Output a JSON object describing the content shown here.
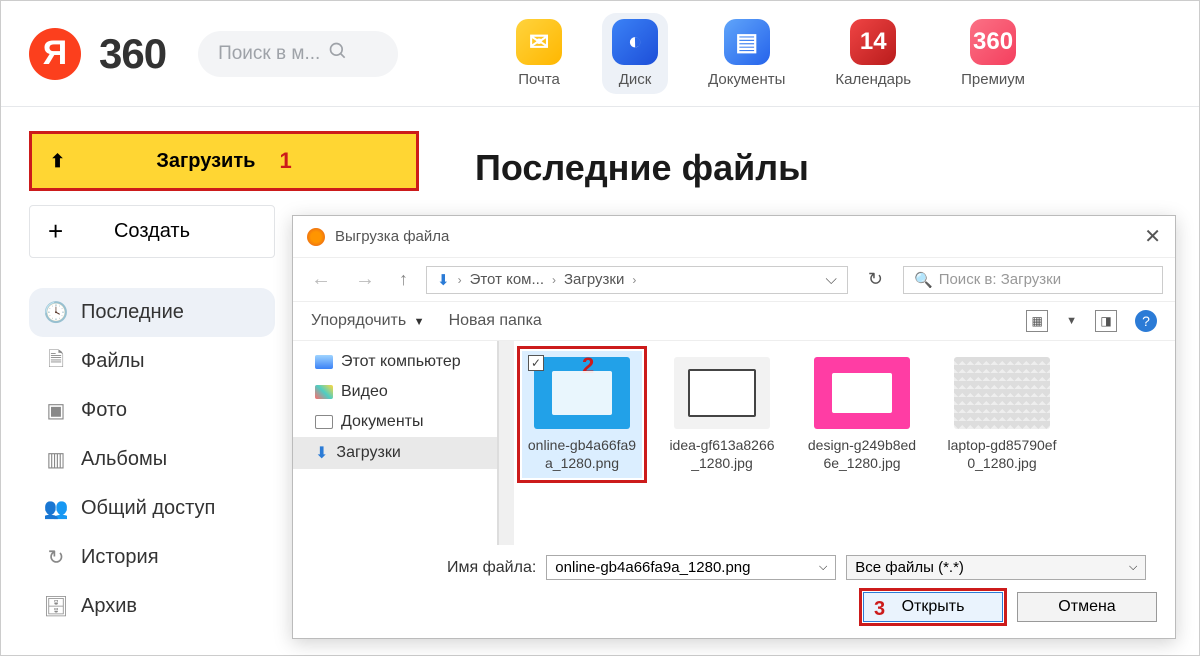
{
  "header": {
    "logo_letter": "Я",
    "logo_text": "360",
    "search_placeholder": "Поиск в м...",
    "services": [
      {
        "label": "Почта"
      },
      {
        "label": "Диск"
      },
      {
        "label": "Документы"
      },
      {
        "label": "Календарь",
        "badge": "14"
      },
      {
        "label": "Премиум",
        "badge": "360"
      }
    ]
  },
  "sidebar": {
    "upload_label": "Загрузить",
    "annotation1": "1",
    "create_label": "Создать",
    "nav": [
      {
        "label": "Последние"
      },
      {
        "label": "Файлы"
      },
      {
        "label": "Фото"
      },
      {
        "label": "Альбомы"
      },
      {
        "label": "Общий доступ"
      },
      {
        "label": "История"
      },
      {
        "label": "Архив"
      }
    ]
  },
  "content": {
    "title": "Последние файлы"
  },
  "dialog": {
    "title": "Выгрузка файла",
    "breadcrumb": {
      "root": "Этот ком...",
      "folder": "Загрузки"
    },
    "search_placeholder": "Поиск в: Загрузки",
    "toolbar": {
      "organize": "Упорядочить",
      "new_folder": "Новая папка"
    },
    "tree": [
      {
        "label": "Этот компьютер"
      },
      {
        "label": "Видео"
      },
      {
        "label": "Документы"
      },
      {
        "label": "Загрузки"
      }
    ],
    "files": [
      {
        "name": "online-gb4a66fa9a_1280.png"
      },
      {
        "name": "idea-gf613a8266_1280.jpg"
      },
      {
        "name": "design-g249b8ed6e_1280.jpg"
      },
      {
        "name": "laptop-gd85790ef0_1280.jpg"
      }
    ],
    "annotation2": "2",
    "footer": {
      "filename_label": "Имя файла:",
      "filename_value": "online-gb4a66fa9a_1280.png",
      "filetype_value": "Все файлы (*.*)",
      "open_label": "Открыть",
      "cancel_label": "Отмена",
      "annotation3": "3"
    }
  }
}
